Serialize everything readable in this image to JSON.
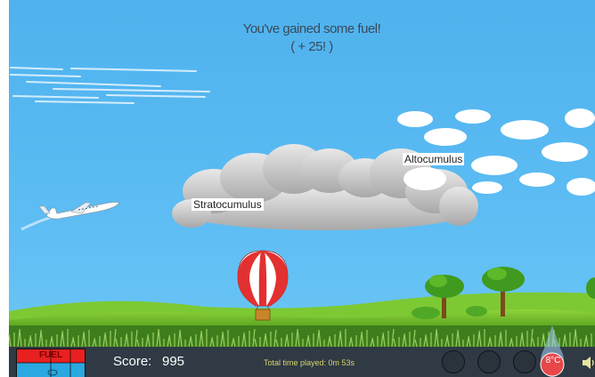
{
  "message": {
    "line1": "You've gained some fuel!",
    "line2": "( + 25! )"
  },
  "clouds": {
    "stratocumulus_label": "Stratocumulus",
    "altocumulus_label": "Altocumulus"
  },
  "hud": {
    "fuel_label": "FUEL",
    "score_label": "Score:",
    "score_value": "995",
    "time_played": "Total time played: 0m 53s",
    "temperature": "8°C"
  },
  "colors": {
    "sky": "#5cbcf3",
    "grass": "#6fbf2a",
    "hud_bg": "#2f3a44",
    "fuel_red": "#e82020",
    "fuel_blue": "#2aa8e0",
    "balloon_red": "#e33030",
    "temp_red": "#e8474a"
  },
  "icons": [
    "airplane-icon",
    "hot-air-balloon-icon",
    "fuel-gauge-icon",
    "thermometer-drop-icon",
    "speaker-icon"
  ]
}
